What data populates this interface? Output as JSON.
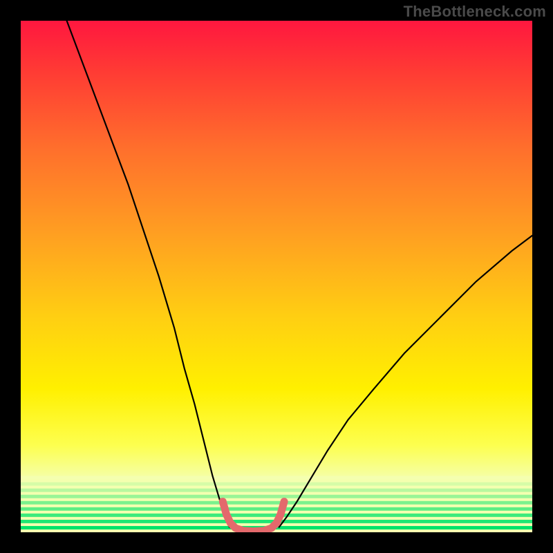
{
  "watermark": "TheBottleneck.com",
  "chart_data": {
    "type": "line",
    "title": "",
    "xlabel": "",
    "ylabel": "",
    "xlim": [
      0,
      100
    ],
    "ylim": [
      0,
      100
    ],
    "grid": false,
    "legend": false,
    "background_gradient": {
      "top_color": "#ff173f",
      "mid_color": "#ffd400",
      "bottom_color": "#00e46a"
    },
    "series": [
      {
        "name": "left-curve",
        "stroke": "#000000",
        "x": [
          9,
          12,
          15,
          18,
          21,
          24,
          27,
          30,
          32,
          34,
          36,
          37.5,
          39,
          40,
          40.8
        ],
        "y": [
          100,
          92,
          84,
          76,
          68,
          59,
          50,
          40,
          32,
          25,
          17,
          11,
          6,
          3,
          1
        ]
      },
      {
        "name": "right-curve",
        "stroke": "#000000",
        "x": [
          50.5,
          52,
          54,
          57,
          60,
          64,
          69,
          75,
          82,
          89,
          96,
          100
        ],
        "y": [
          1,
          3,
          6,
          11,
          16,
          22,
          28,
          35,
          42,
          49,
          55,
          58
        ]
      },
      {
        "name": "trough-band",
        "stroke": "#e4696c",
        "thick": true,
        "x": [
          39.5,
          40.2,
          41,
          42,
          43.5,
          45.5,
          47.5,
          49,
          50,
          50.8,
          51.5
        ],
        "y": [
          6,
          3.5,
          1.8,
          0.8,
          0.3,
          0.2,
          0.3,
          0.8,
          1.8,
          3.5,
          6
        ]
      }
    ],
    "green_bands": {
      "count": 9,
      "top_y": 11,
      "bottom_y": 0
    }
  }
}
